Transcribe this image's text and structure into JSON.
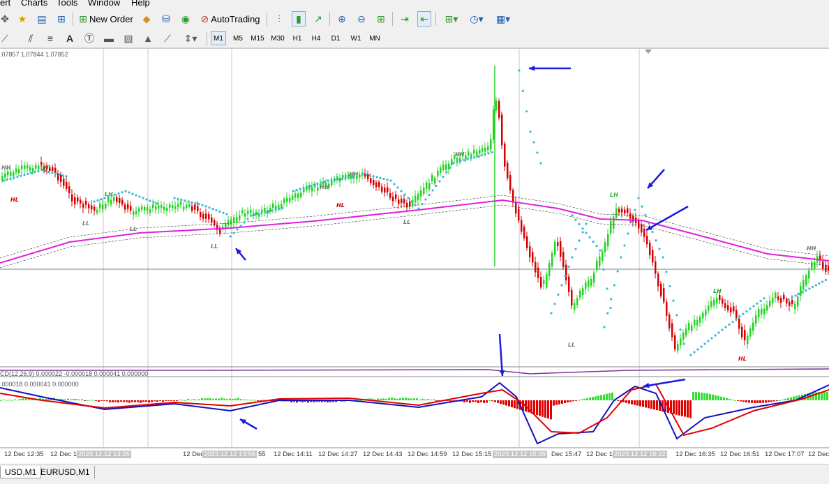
{
  "menu": [
    "ert",
    "Charts",
    "Tools",
    "Window",
    "Help"
  ],
  "toolbar": {
    "new_order": "New Order",
    "auto_trading": "AutoTrading"
  },
  "timeframes": [
    "M1",
    "M5",
    "M15",
    "M30",
    "H1",
    "H4",
    "D1",
    "W1",
    "MN"
  ],
  "active_timeframe": "M1",
  "chart": {
    "price_header": ".07857 1.07844 1.07852",
    "macd_label": "CD(12,26,9) 0.000022 -0.000018 0.000041 0.000000",
    "osma_label": ".000018 0.000041 0.000000",
    "swing_labels": {
      "hh": "HH",
      "hl": "HL",
      "ll": "LL",
      "lh": "LH"
    }
  },
  "time_axis": [
    {
      "text": "12 Dec 12:35",
      "hl": false
    },
    {
      "text": "12 Dec 1",
      "hl": false
    },
    {
      "text": "2023.12.12 13:26",
      "hl": true
    },
    {
      "text": "12 Dec",
      "hl": false
    },
    {
      "text": "2023.12.12 13:56",
      "hl": true
    },
    {
      "text": "55",
      "hl": false
    },
    {
      "text": "12 Dec 14:11",
      "hl": false
    },
    {
      "text": "12 Dec 14:27",
      "hl": false
    },
    {
      "text": "12 Dec 14:43",
      "hl": false
    },
    {
      "text": "12 Dec 14:59",
      "hl": false
    },
    {
      "text": "12 Dec 15:15",
      "hl": false
    },
    {
      "text": "2023.12.12 15:39",
      "hl": true
    },
    {
      "text": "Dec 15:47",
      "hl": false
    },
    {
      "text": "12 Dec 1",
      "hl": false
    },
    {
      "text": "2023.12.12 16:22",
      "hl": true
    },
    {
      "text": "12 Dec 16:35",
      "hl": false
    },
    {
      "text": "12 Dec 16:51",
      "hl": false
    },
    {
      "text": "12 Dec 17:07",
      "hl": false
    },
    {
      "text": "12 Dec",
      "hl": false
    }
  ],
  "tabs": [
    {
      "label": "USD,M1",
      "active": true
    },
    {
      "label": "EURUSD,M1",
      "active": false
    }
  ],
  "colors": {
    "bull": "#22d322",
    "bear": "#d40000",
    "ma": "#e020e0",
    "psar": "#38b8d8",
    "arrow": "#1a1ae0",
    "macd_main": "#1010c0",
    "macd_signal": "#e00000",
    "hist_pos": "#30e030",
    "hist_neg": "#e00000"
  }
}
